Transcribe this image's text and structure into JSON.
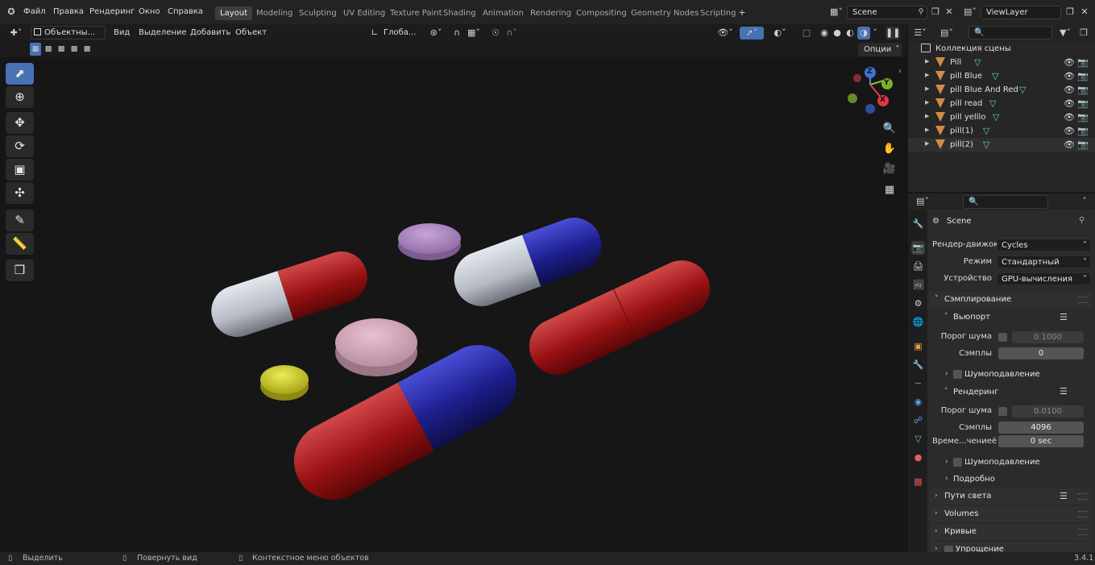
{
  "topbar": {
    "menus": [
      "Файл",
      "Правка",
      "Рендеринг",
      "Окно",
      "Справка"
    ],
    "workspaces": [
      "Layout",
      "Modeling",
      "Sculpting",
      "UV Editing",
      "Texture Paint",
      "Shading",
      "Animation",
      "Rendering",
      "Compositing",
      "Geometry Nodes",
      "Scripting"
    ],
    "active_workspace": "Layout",
    "add_workspace": "+",
    "scene": "Scene",
    "view_layer": "ViewLayer"
  },
  "viewport_header": {
    "mode": "Объектны...",
    "menus": [
      "Вид",
      "Выделение",
      "Добавить",
      "Объект"
    ],
    "transform_orientation": "Глоба...",
    "options": "Опции"
  },
  "outliner": {
    "collection": "Коллекция сцены",
    "objects": [
      "Pill",
      "pill Blue",
      "pill Blue And Red",
      "pill read",
      "pill yelllo",
      "pill(1)",
      "pill(2)"
    ]
  },
  "properties": {
    "scene_name": "Scene",
    "render_engine_label": "Рендер-движок",
    "render_engine": "Cycles",
    "mode_label": "Режим",
    "mode": "Стандартный",
    "device_label": "Устройство",
    "device": "GPU-вычисления",
    "sampling": "Сэмплирование",
    "viewport": "Вьюпорт",
    "noise_threshold_label": "Порог шума",
    "viewport_noise_threshold": "0.1000",
    "samples_label": "Сэмплы",
    "viewport_samples": "0",
    "denoise_label": "Шумоподавление",
    "render": "Рендеринг",
    "render_noise_threshold": "0.0100",
    "render_samples": "4096",
    "time_limit_label": "Време...чениеё",
    "time_limit": "0 sec",
    "advanced": "Подробно",
    "light_paths": "Пути света",
    "volumes": "Volumes",
    "curves": "Кривые",
    "simplify": "Упрощение"
  },
  "statusbar": {
    "select": "Выделить",
    "rotate_view": "Повернуть вид",
    "context_menu": "Контекстное меню объектов",
    "version": "3.4.1"
  },
  "gizmo": {
    "x": "X",
    "y": "Y",
    "z": "Z"
  }
}
